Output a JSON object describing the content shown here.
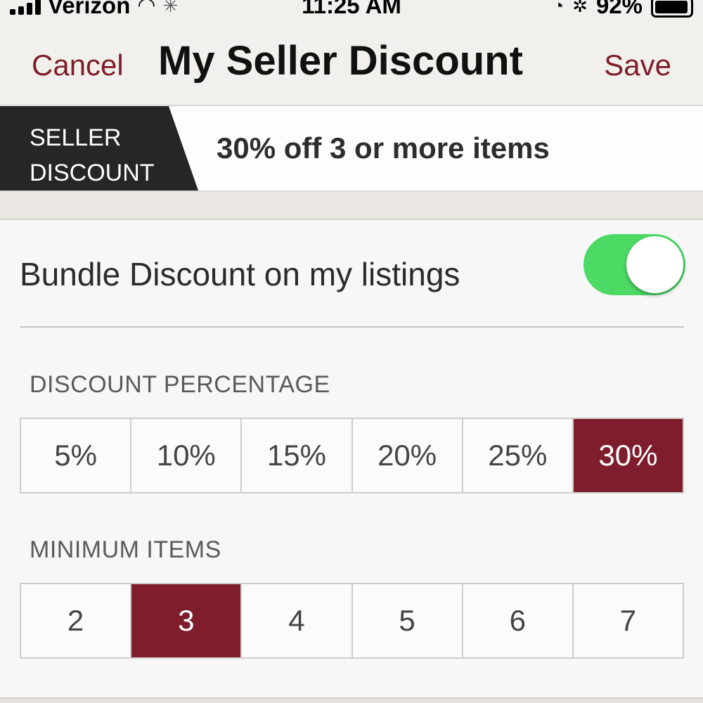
{
  "status_bar": {
    "carrier": "Verizon",
    "time": "11:25 AM",
    "battery_percent": "92%",
    "icons": [
      "signal-icon",
      "wifi-icon",
      "activity-spinner-icon",
      "clock-lock-icon",
      "bluetooth-icon",
      "battery-icon"
    ]
  },
  "nav": {
    "cancel_label": "Cancel",
    "title": "My Seller Discount",
    "save_label": "Save",
    "accent_color": "#7f1d2c"
  },
  "banner": {
    "tag": "SELLER\nDISCOUNT",
    "summary": "30% off 3 or more items"
  },
  "bundle": {
    "label": "Bundle Discount on my listings",
    "enabled": true,
    "toggle_color": "#4cd964"
  },
  "discount_percentage": {
    "label": "DISCOUNT PERCENTAGE",
    "options": [
      "5%",
      "10%",
      "15%",
      "20%",
      "25%",
      "30%"
    ],
    "selected": "30%"
  },
  "minimum_items": {
    "label": "MINIMUM ITEMS",
    "options": [
      "2",
      "3",
      "4",
      "5",
      "6",
      "7"
    ],
    "selected": "3"
  }
}
